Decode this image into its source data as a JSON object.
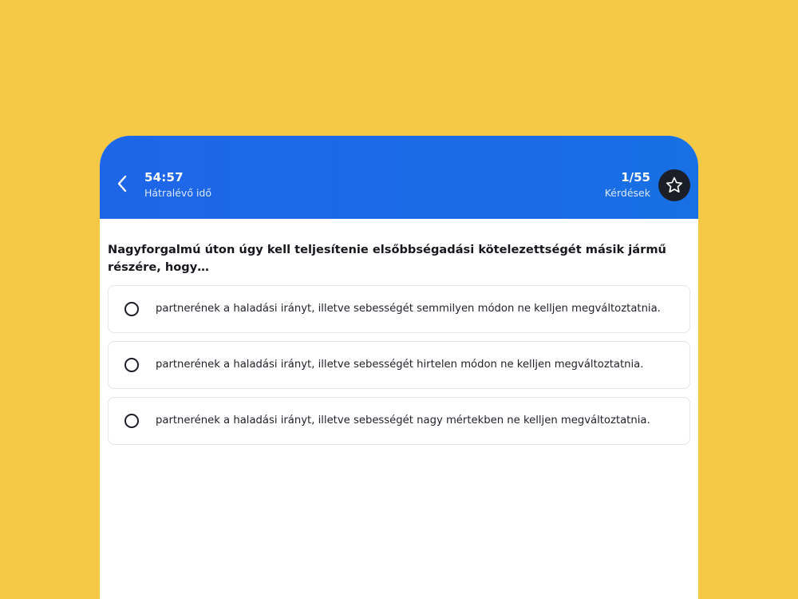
{
  "header": {
    "back_icon": "chevron-left-icon",
    "timer_value": "54:57",
    "timer_label": "Hátralévő idő",
    "progress_value": "1/55",
    "progress_label": "Kérdések",
    "favorite_icon": "star-icon",
    "accent_color": "#1A6AE6"
  },
  "question": {
    "text": "Nagyforgalmú úton úgy kell teljesítenie elsőbbségadási kötelezettségét másik jármű részére, hogy…"
  },
  "options": [
    {
      "text": "partnerének a haladási irányt, illetve sebességét semmilyen módon ne kelljen megváltoztatnia.",
      "selected": false
    },
    {
      "text": "partnerének a haladási irányt, illetve sebességét hirtelen módon ne kelljen megváltoztatnia.",
      "selected": false
    },
    {
      "text": "partnerének a haladási irányt, illetve sebességét nagy mértekben ne kelljen megváltoztatnia.",
      "selected": false
    }
  ],
  "colors": {
    "background": "#F5C945",
    "card": "#FFFFFF",
    "star_button": "#1B1E27"
  }
}
